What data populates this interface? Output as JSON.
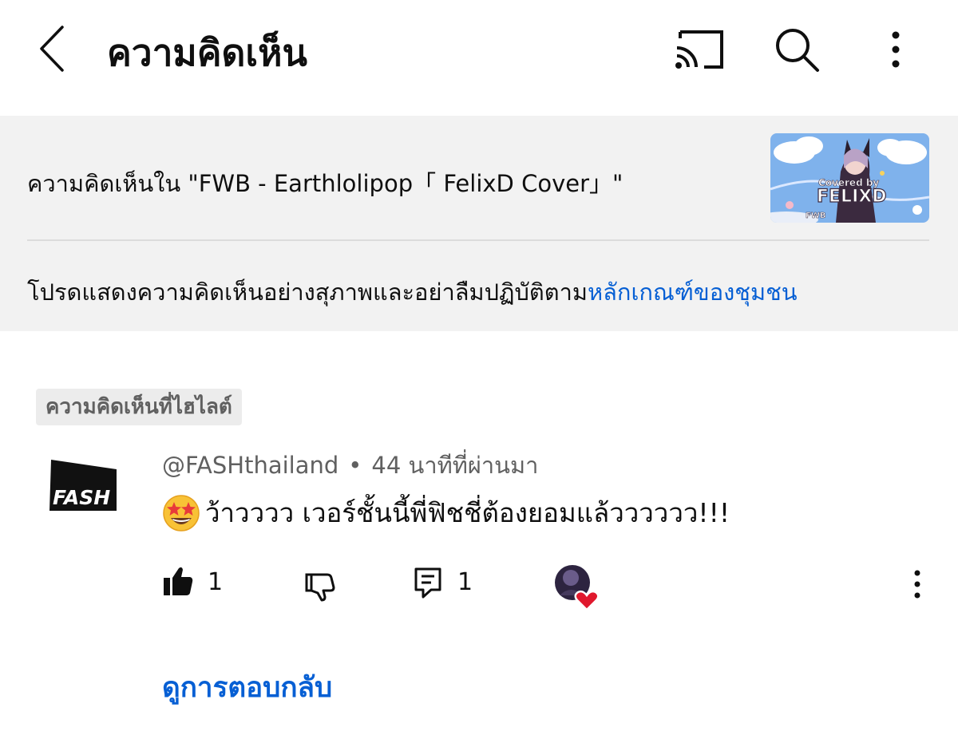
{
  "header": {
    "title": "ความคิดเห็น",
    "back_icon": "chevron-left-icon",
    "cast_icon": "cast-icon",
    "search_icon": "search-icon",
    "more_icon": "more-vert-icon"
  },
  "info": {
    "video_line": "ความคิดเห็นใน \"FWB - Earthlolipop「 FelixD Cover」\"",
    "thumbnail_text_top": "Covered by",
    "thumbnail_text_main": "FELIXD",
    "thumbnail_text_corner": "FWB",
    "guideline_prefix": "โปรดแสดงความคิดเห็นอย่างสุภาพและอย่าลืมปฏิบัติตาม",
    "guideline_link": "หลักเกณฑ์ของชุมชน"
  },
  "comment": {
    "badge": "ความคิดเห็นที่ไฮไลต์",
    "avatar_text": "FASH",
    "author": "@FASHthailand",
    "separator": "•",
    "time": "44 นาทีที่ผ่านมา",
    "text": "ว้าวววว เวอร์ชั้นนี้พี่ฟิชชี่ต้องยอมแล้วววววว!!!",
    "emoji": "star-struck-emoji",
    "like_count": "1",
    "reply_count": "1"
  },
  "replies": {
    "view_label": "ดูการตอบกลับ"
  },
  "colors": {
    "link": "#065fd4",
    "panel": "#f2f2f2",
    "heart": "#e0182d"
  }
}
